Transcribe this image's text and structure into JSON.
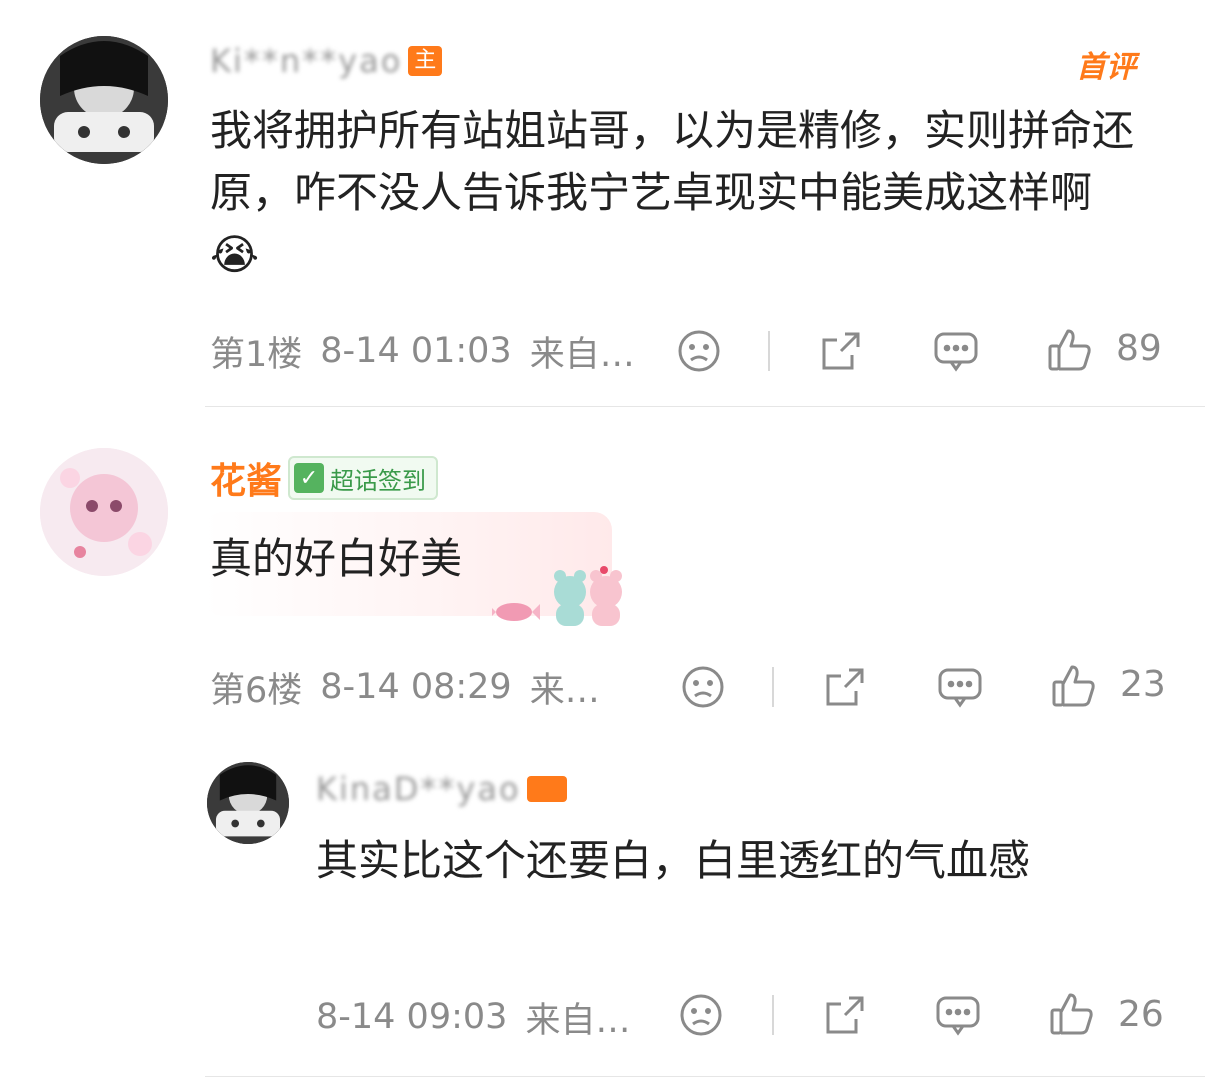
{
  "comments": [
    {
      "user": "Ki**n**yao",
      "badge": "主",
      "first_tag": "首评",
      "text": "我将拥护所有站姐站哥，以为是精修，实则拼命还原，咋不没人告诉我宁艺卓现实中能美成这样啊😭",
      "floor": "第1楼",
      "time": "8-14 01:03",
      "source": "来自…",
      "likes": "89"
    },
    {
      "user": "花酱",
      "badge": "超话签到",
      "text": "真的好白好美",
      "floor": "第6楼",
      "time": "8-14 08:29",
      "source": "来…",
      "likes": "23"
    }
  ],
  "reply": {
    "user": "KinaD**yao",
    "text": "其实比这个还要白，白里透红的气血感",
    "time": "8-14 09:03",
    "source": "来自…",
    "likes": "26"
  },
  "icons": [
    "dislike-icon",
    "share-icon",
    "comment-icon",
    "like-icon"
  ],
  "colors": {
    "accent": "#ff7a1a",
    "meta_gray": "#8a8a8a",
    "text": "#222222"
  }
}
